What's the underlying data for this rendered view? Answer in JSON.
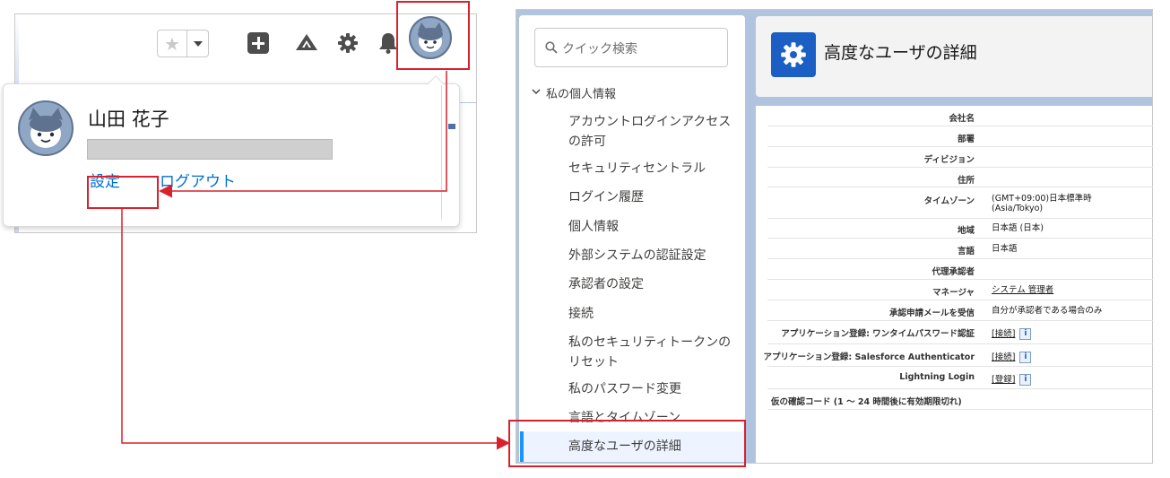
{
  "header": {
    "favorites_star": "★",
    "icons": [
      "favorites-star-icon",
      "chevron-down-icon",
      "plus-icon",
      "trailhead-icon",
      "gear-icon",
      "bell-icon",
      "avatar-icon"
    ]
  },
  "user_menu": {
    "name": "山田 花子",
    "settings_label": "設定",
    "logout_label": "ログアウト"
  },
  "sidebar": {
    "search_placeholder": "クイック検索",
    "section_label": "私の個人情報",
    "items": [
      {
        "label": "アカウントログインアクセスの許可"
      },
      {
        "label": "セキュリティセントラル"
      },
      {
        "label": "ログイン履歴"
      },
      {
        "label": "個人情報"
      },
      {
        "label": "外部システムの認証設定"
      },
      {
        "label": "承認者の設定"
      },
      {
        "label": "接続"
      },
      {
        "label": "私のセキュリティトークンのリセット"
      },
      {
        "label": "私のパスワード変更"
      },
      {
        "label": "言語とタイムゾーン"
      },
      {
        "label": "高度なユーザの詳細"
      }
    ]
  },
  "page": {
    "title": "高度なユーザの詳細"
  },
  "details": {
    "rows": [
      {
        "label": "会社名",
        "value": ""
      },
      {
        "label": "部署",
        "value": ""
      },
      {
        "label": "ディビジョン",
        "value": ""
      },
      {
        "label": "住所",
        "value": ""
      },
      {
        "label": "タイムゾーン",
        "value": "(GMT+09:00)日本標準時",
        "value2": "(Asia/Tokyo)"
      },
      {
        "label": "地域",
        "value": "日本語 (日本)"
      },
      {
        "label": "言語",
        "value": "日本語"
      },
      {
        "label": "代理承認者",
        "value": ""
      },
      {
        "label": "マネージャ",
        "value": "システム 管理者"
      },
      {
        "label": "承認申請メールを受信",
        "value": "自分が承認者である場合のみ"
      },
      {
        "label": "アプリケーション登録: ワンタイムパスワード認証",
        "value": "[接続]"
      },
      {
        "label": "アプリケーション登録: Salesforce Authenticator",
        "value": "[接続]"
      },
      {
        "label": "Lightning Login",
        "value": "[登録]"
      },
      {
        "label": "仮の確認コード (1 ～ 24 時間後に有効期限切れ)",
        "value": ""
      }
    ],
    "info_glyph": "i"
  },
  "colors": {
    "brand_blue": "#1b5fc4",
    "link_blue": "#0070d2",
    "highlight_red": "#d9212c",
    "active_bar": "#1b96ff"
  }
}
